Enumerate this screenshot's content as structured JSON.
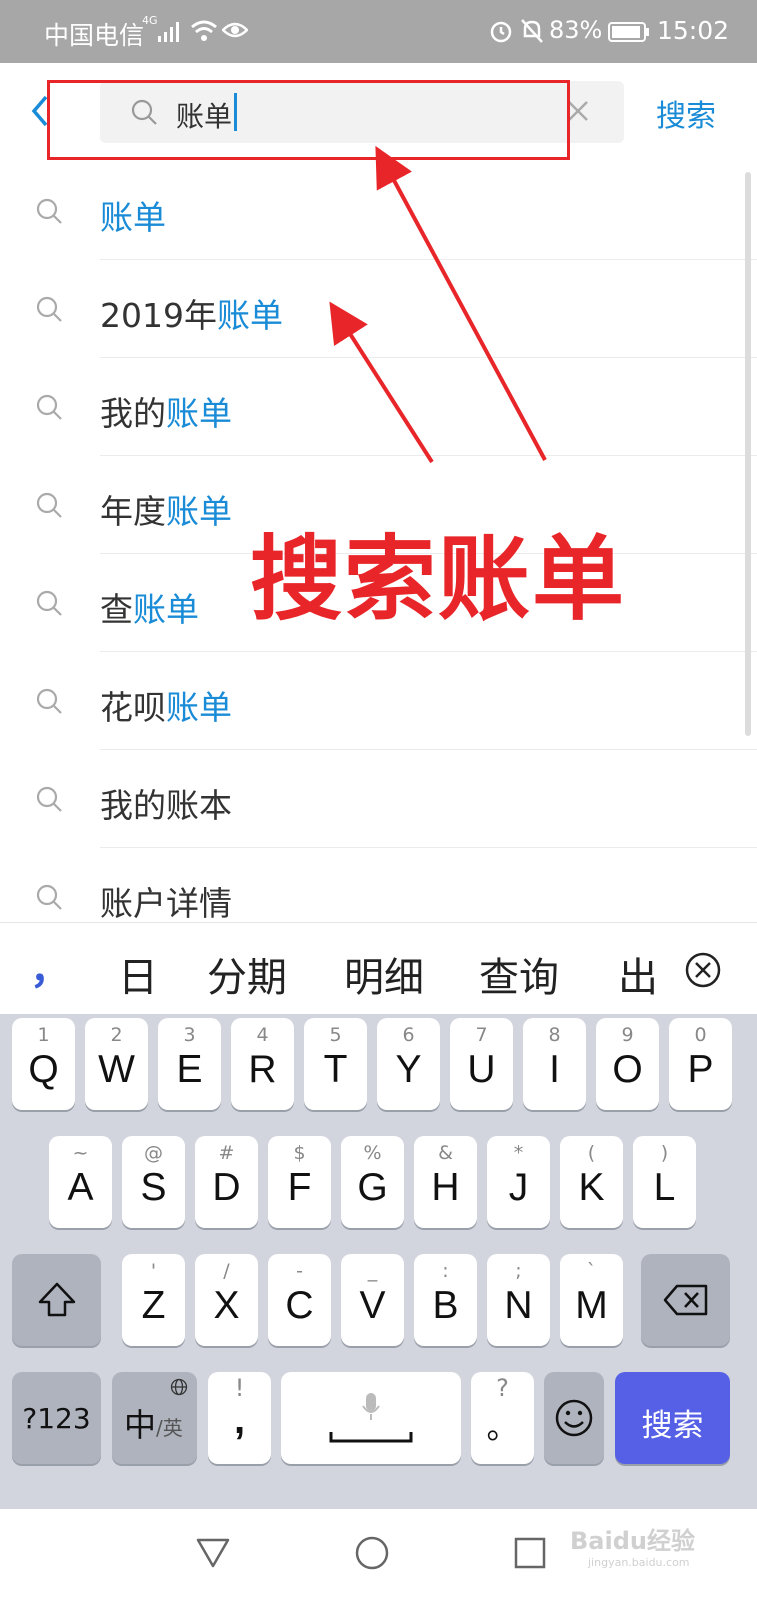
{
  "status_bar": {
    "carrier": "中国电信",
    "network": "4G",
    "battery_percent": "83%",
    "time": "15:02"
  },
  "search": {
    "query": "账单",
    "button_label": "搜索"
  },
  "suggestions": [
    {
      "prefix": "",
      "highlight": "账单"
    },
    {
      "prefix": "2019年",
      "highlight": "账单"
    },
    {
      "prefix": "我的",
      "highlight": "账单"
    },
    {
      "prefix": "年度",
      "highlight": "账单"
    },
    {
      "prefix": "查",
      "highlight": "账单"
    },
    {
      "prefix": "花呗",
      "highlight": "账单"
    },
    {
      "prefix": "我的账本",
      "highlight": ""
    },
    {
      "prefix": "账户详情",
      "highlight": ""
    }
  ],
  "annotation": {
    "text": "搜索账单",
    "color": "#e8262a"
  },
  "ime": {
    "punct": "，",
    "candidates": [
      "日",
      "分期",
      "明细",
      "查询",
      "出"
    ],
    "row1": [
      {
        "top": "1",
        "main": "Q"
      },
      {
        "top": "2",
        "main": "W"
      },
      {
        "top": "3",
        "main": "E"
      },
      {
        "top": "4",
        "main": "R"
      },
      {
        "top": "5",
        "main": "T"
      },
      {
        "top": "6",
        "main": "Y"
      },
      {
        "top": "7",
        "main": "U"
      },
      {
        "top": "8",
        "main": "I"
      },
      {
        "top": "9",
        "main": "O"
      },
      {
        "top": "0",
        "main": "P"
      }
    ],
    "row2": [
      {
        "top": "~",
        "main": "A"
      },
      {
        "top": "@",
        "main": "S"
      },
      {
        "top": "#",
        "main": "D"
      },
      {
        "top": "$",
        "main": "F"
      },
      {
        "top": "%",
        "main": "G"
      },
      {
        "top": "&",
        "main": "H"
      },
      {
        "top": "*",
        "main": "J"
      },
      {
        "top": "(",
        "main": "K"
      },
      {
        "top": ")",
        "main": "L"
      }
    ],
    "row3": [
      {
        "top": "'",
        "main": "Z"
      },
      {
        "top": "/",
        "main": "X"
      },
      {
        "top": "-",
        "main": "C"
      },
      {
        "top": "_",
        "main": "V"
      },
      {
        "top": ":",
        "main": "B"
      },
      {
        "top": ";",
        "main": "N"
      },
      {
        "top": "`",
        "main": "M"
      }
    ],
    "num_key": "?123",
    "lang_key_main": "中",
    "lang_key_sub": "/英",
    "comma_key": {
      "top": "!",
      "main": ","
    },
    "period_key": {
      "top": "?",
      "main": "。"
    },
    "enter_key": "搜索"
  },
  "colors": {
    "accent": "#1a8bd6",
    "keyboard_bg": "#d2d5dd",
    "enter_key": "#5560e6"
  },
  "watermark": {
    "brand": "Baidu经验",
    "url": "jingyan.baidu.com"
  }
}
